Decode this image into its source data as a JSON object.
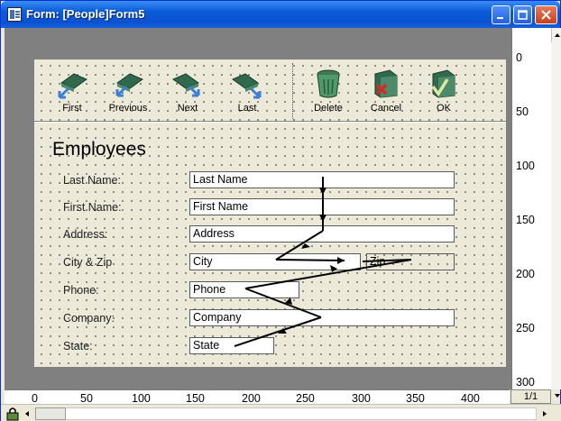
{
  "window": {
    "title": "Form: [People]Form5"
  },
  "toolbar": {
    "buttons": [
      {
        "label": "First",
        "icon": "first-record-icon"
      },
      {
        "label": "Previous",
        "icon": "previous-record-icon"
      },
      {
        "label": "Next",
        "icon": "next-record-icon"
      },
      {
        "label": "Last",
        "icon": "last-record-icon"
      },
      {
        "label": "Delete",
        "icon": "trash-can-icon"
      },
      {
        "label": "Cancel",
        "icon": "cancel-folder-icon"
      },
      {
        "label": "OK",
        "icon": "ok-folder-icon"
      }
    ]
  },
  "form": {
    "title": "Employees",
    "labels": {
      "last_name": "Last Name:",
      "first_name": "First Name:",
      "address": "Address:",
      "city_zip": "City & Zip",
      "phone": "Phone:",
      "company": "Company:",
      "state": "State:"
    },
    "fields": {
      "last_name": "Last Name",
      "first_name": "First Name",
      "address": "Address",
      "city": "City",
      "zip": "Zip",
      "phone": "Phone",
      "company": "Company",
      "state": "State"
    }
  },
  "vertical_ruler": {
    "labels": [
      "0",
      "50",
      "100",
      "150",
      "200",
      "250",
      "300"
    ]
  },
  "horizontal_ruler": {
    "labels": [
      "0",
      "50",
      "100",
      "150",
      "200",
      "250",
      "300",
      "350",
      "400"
    ]
  },
  "page_indicator": "1/1",
  "colors": {
    "titlebar": "#0a5bd8",
    "form_background": "#ece9d8",
    "workspace": "#808080"
  }
}
